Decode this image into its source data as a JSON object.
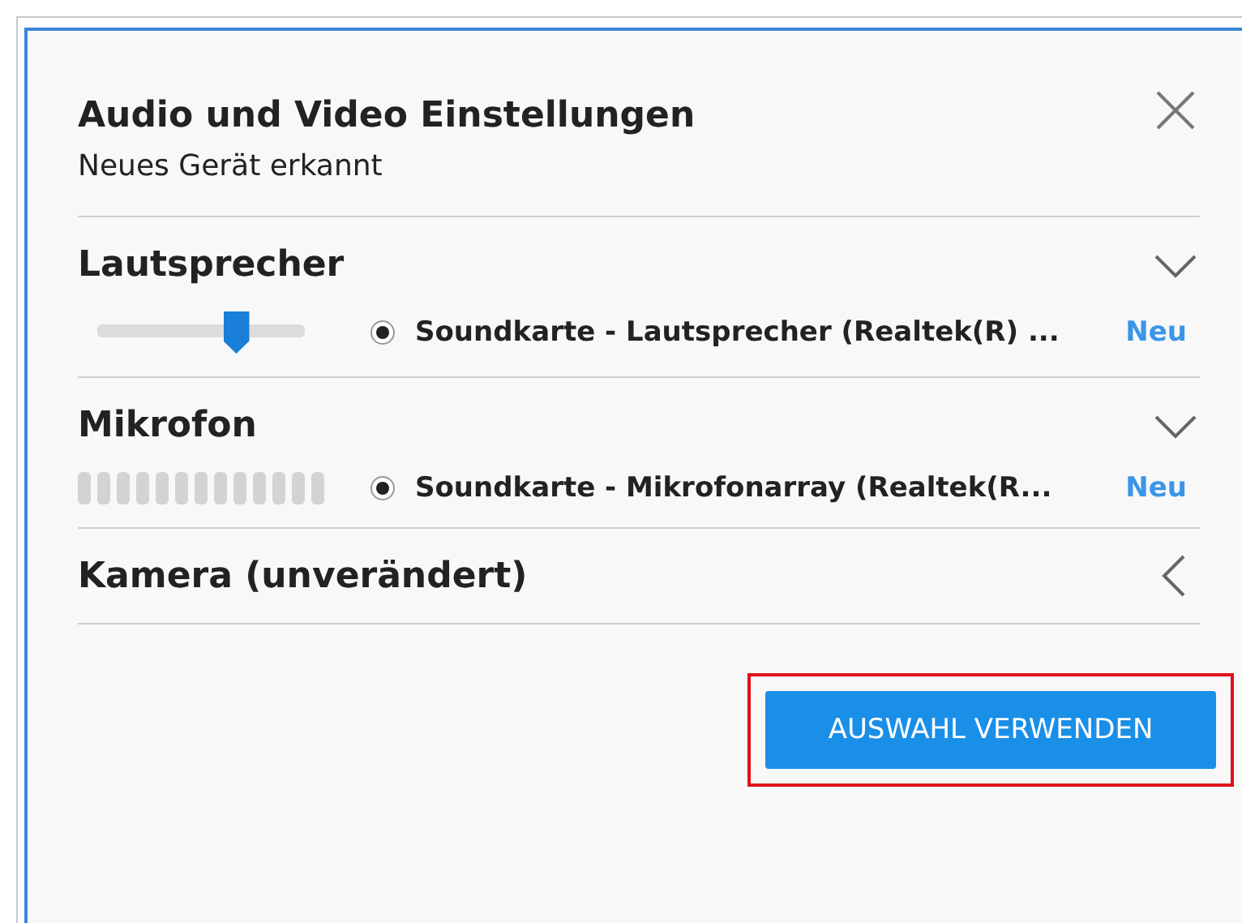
{
  "dialog": {
    "title": "Audio und Video Einstellungen",
    "subtitle": "Neues Gerät erkannt"
  },
  "sections": [
    {
      "title": "Lautsprecher",
      "expanded": true,
      "device": {
        "kind": "slider",
        "level": 0.67,
        "selected": true,
        "name": "Soundkarte - Lautsprecher (Realtek(R) ...",
        "badge": "Neu"
      }
    },
    {
      "title": "Mikrofon",
      "expanded": true,
      "device": {
        "kind": "meter",
        "selected": true,
        "name": "Soundkarte - Mikrofonarray (Realtek(R...",
        "badge": "Neu"
      }
    },
    {
      "title": "Kamera (unverändert)",
      "expanded": false
    }
  ],
  "button": {
    "label": "AUSWAHL VERWENDEN",
    "highlighted": true
  }
}
